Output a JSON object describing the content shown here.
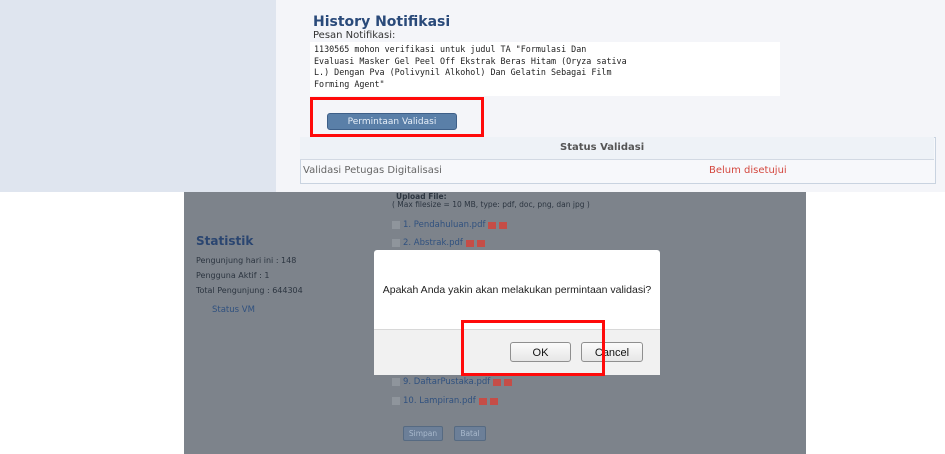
{
  "history": {
    "title": "History Notifikasi",
    "label": "Pesan Notifikasi:",
    "message_lines": [
      "1130565 mohon verifikasi untuk judul TA \"Formulasi Dan",
      "Evaluasi Masker Gel Peel Off Ekstrak Beras Hitam (Oryza sativa",
      "L.) Dengan Pva (Polivynil Alkohol) Dan Gelatin Sebagai Film",
      "Forming Agent\""
    ],
    "button": "Permintaan Validasi",
    "status_title": "Status Validasi",
    "status_name": "Validasi Petugas Digitalisasi",
    "status_value": "Belum disetujui"
  },
  "sidebar": {
    "title": "Statistik",
    "lines": [
      "Pengunjung hari ini : 148",
      "Pengguna Aktif : 1",
      "Total Pengunjung : 644304"
    ],
    "link": "Status VM"
  },
  "upload": {
    "label": "Upload File:",
    "note": "( Max filesize = 10 MB, type: pdf, doc, png, dan jpg )",
    "files": [
      "1. Pendahuluan.pdf",
      "2. Abstrak.pdf",
      "9. DaftarPustaka.pdf",
      "10. Lampiran.pdf"
    ],
    "buttons": [
      "Simpan",
      "Batal"
    ]
  },
  "dialog": {
    "message": "Apakah Anda yakin akan melakukan permintaan validasi?",
    "ok": "OK",
    "cancel": "Cancel"
  },
  "colors": {
    "highlight": "#ff0a0a",
    "status_pending": "#d4473e",
    "overlay": "#7d838b"
  }
}
